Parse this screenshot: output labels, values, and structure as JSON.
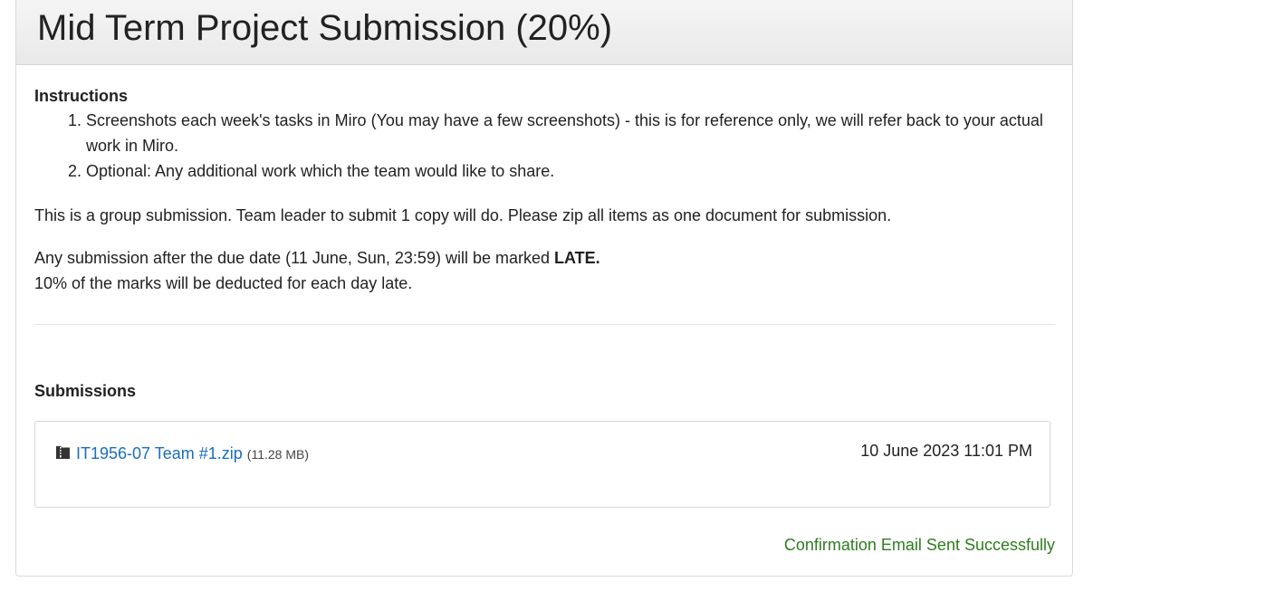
{
  "page": {
    "title": "Mid Term Project Submission (20%)"
  },
  "instructions": {
    "heading": "Instructions",
    "items": [
      "Screenshots each week's tasks in Miro (You may have a few screenshots) - this is for reference only, we will refer back to your actual work in Miro.",
      "Optional: Any additional work which the team would like to share."
    ],
    "group_note": "This is a group submission. Team leader to submit 1 copy will do.  Please zip all items as one document for submission.",
    "late_note_prefix": "Any submission after the due date (11 June, Sun, 23:59) will be marked ",
    "late_note_bold": "LATE.",
    "deduction_note": "10% of the marks will be deducted for each day late."
  },
  "submissions": {
    "heading": "Submissions",
    "files": [
      {
        "name": "IT1956-07 Team #1.zip",
        "size": "(11.28 MB)",
        "date": "10 June 2023 11:01 PM",
        "icon": "file-icon"
      }
    ],
    "confirmation": "Confirmation Email Sent Successfully"
  },
  "colors": {
    "link": "#1a6dbd",
    "success": "#2d7d1f",
    "header_bg": "#eeeeee"
  }
}
